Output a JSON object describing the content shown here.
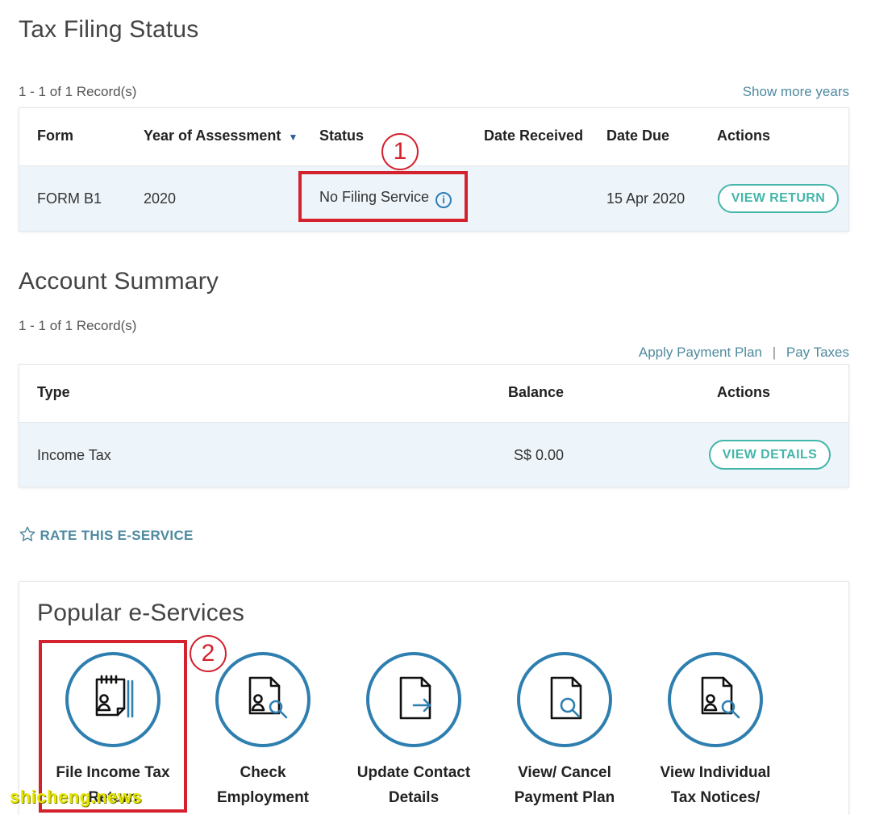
{
  "tax_filing": {
    "title": "Tax Filing Status",
    "records": "1 - 1 of 1 Record(s)",
    "show_more": "Show more years",
    "headers": {
      "form": "Form",
      "year": "Year of Assessment",
      "sort": "▼",
      "status": "Status",
      "received": "Date Received",
      "due": "Date Due",
      "actions": "Actions"
    },
    "row": {
      "form": "FORM B1",
      "year": "2020",
      "status": "No Filing Service",
      "received": "",
      "due": "15 Apr 2020",
      "action": "VIEW RETURN"
    }
  },
  "account_summary": {
    "title": "Account Summary",
    "records": "1 - 1 of 1 Record(s)",
    "apply_plan": "Apply Payment Plan",
    "separator": "|",
    "pay_taxes": "Pay Taxes",
    "headers": {
      "type": "Type",
      "balance": "Balance",
      "actions": "Actions"
    },
    "row": {
      "type": "Income Tax",
      "balance": "S$ 0.00",
      "action": "VIEW DETAILS"
    }
  },
  "rate_service": "RATE THIS E-SERVICE",
  "popular": {
    "title": "Popular e-Services",
    "items": [
      {
        "line1": "File Income Tax",
        "line2": "Return",
        "icon": "file-return-icon"
      },
      {
        "line1": "Check",
        "line2": "Employment",
        "icon": "check-employment-icon"
      },
      {
        "line1": "Update Contact",
        "line2": "Details",
        "icon": "update-contact-icon"
      },
      {
        "line1": "View/ Cancel",
        "line2": "Payment Plan",
        "icon": "payment-plan-icon"
      },
      {
        "line1": "View Individual",
        "line2": "Tax Notices/",
        "icon": "tax-notices-icon"
      }
    ]
  },
  "annotations": {
    "marker1": "1",
    "marker2": "2"
  },
  "watermark": "shicheng.news",
  "colors": {
    "accent_teal": "#44b6aa",
    "icon_blue": "#2e7fb0",
    "annotation_red": "#d3222d",
    "link": "#4f8aa0"
  }
}
